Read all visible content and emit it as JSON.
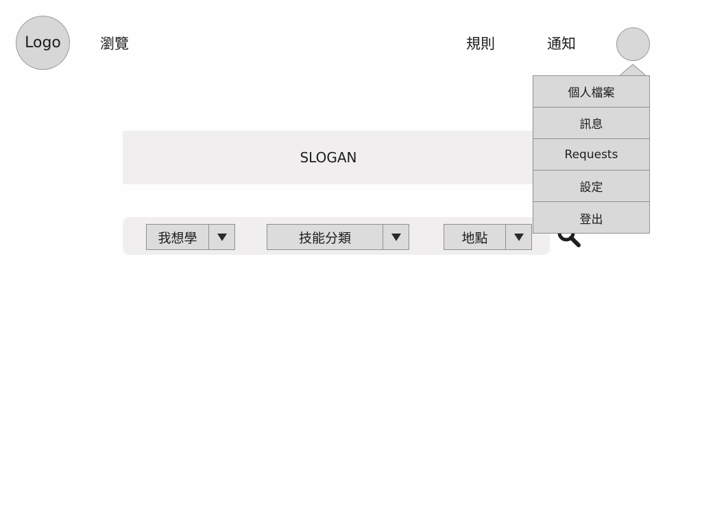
{
  "header": {
    "logo_label": "Logo",
    "browse_label": "瀏覽",
    "rules_label": "規則",
    "notifications_label": "通知"
  },
  "hero": {
    "slogan": "SLOGAN"
  },
  "search": {
    "filters": [
      {
        "label": "我想學"
      },
      {
        "label": "技能分類"
      },
      {
        "label": "地點"
      }
    ],
    "search_icon": "magnifier-icon"
  },
  "user_menu": {
    "items": [
      {
        "label": "個人檔案"
      },
      {
        "label": "訊息"
      },
      {
        "label": "Requests"
      },
      {
        "label": "設定"
      },
      {
        "label": "登出"
      }
    ]
  },
  "colors": {
    "background": "#fefefe",
    "panel": "#f0eeee",
    "control": "#dcdcdc",
    "border": "#8e8e8e",
    "text": "#1c1c1c"
  }
}
